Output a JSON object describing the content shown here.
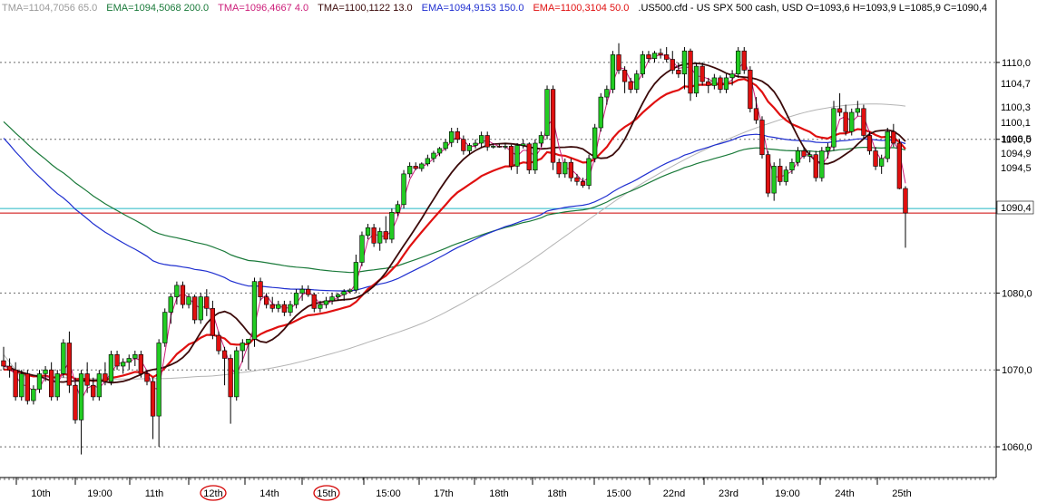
{
  "header": {
    "items": [
      {
        "text": "TMA=1104,7056  65.0",
        "color": "#9a9a9a"
      },
      {
        "text": "EMA=1094,5068  200.0",
        "color": "#1a7a3a"
      },
      {
        "text": "TMA=1096,4667  4.0",
        "color": "#cc1f7a"
      },
      {
        "text": "TMA=1100,1122  13.0",
        "color": "#3b0a0a"
      },
      {
        "text": "EMA=1094,9153  150.0",
        "color": "#1f2fd0"
      },
      {
        "text": "EMA=1100,3104  50.0",
        "color": "#e01010"
      },
      {
        "text": ".US500.cfd - US SPX 500 cash, USD O=1093,6 H=1093,9 L=1085,9 C=1090,4",
        "color": "#000000"
      }
    ]
  },
  "colors": {
    "bull": "#22cc22",
    "bear": "#e01010",
    "grid": "#6a6a6a",
    "tma65": "#b4b4b4",
    "ema200": "#1a7a3a",
    "tma4": "#cc1f7a",
    "tma13": "#3b0a0a",
    "ema150": "#1f2fd0",
    "ema50": "#e01010",
    "cyan": "#22b7c4",
    "redline": "#cc0000"
  },
  "chart_data": {
    "type": "candlestick",
    "symbol": ".US500.cfd",
    "ylim": [
      1056,
      1116
    ],
    "y_ticks": [
      "1110,0",
      "1100,0",
      "1080,0",
      "1070,0",
      "1060,0"
    ],
    "x_ticks": [
      "10th",
      "19:00",
      "11th",
      "12th",
      "14th",
      "15th",
      "15:00",
      "17th",
      "18th",
      "18th",
      "15:00",
      "22nd",
      "23rd",
      "19:00",
      "24th",
      "25th"
    ],
    "circled_x_ticks": [
      "12th",
      "15th"
    ],
    "price_labels": [
      {
        "text": "1104,7",
        "value": 1104.7,
        "series": "tma65"
      },
      {
        "text": "1100,3",
        "value": 1100.3,
        "series": "ema50"
      },
      {
        "text": "1100,1",
        "value": 1100.1,
        "series": "tma13"
      },
      {
        "text": "1096,5",
        "value": 1096.5,
        "series": "tma4"
      },
      {
        "text": "1094,9",
        "value": 1094.9,
        "series": "ema150"
      },
      {
        "text": "1094,5",
        "value": 1094.5,
        "series": "ema200"
      },
      {
        "text": "1090,4",
        "value": 1090.4,
        "series": "last"
      }
    ],
    "horizontal_lines": [
      {
        "value": 1091.0,
        "color": "cyan"
      },
      {
        "value": 1090.4,
        "color": "redline"
      }
    ],
    "candles_ohlc": [
      [
        1071.2,
        1073.0,
        1070.0,
        1070.5
      ],
      [
        1070.5,
        1071.5,
        1069.0,
        1070.0
      ],
      [
        1070.0,
        1071.0,
        1066.0,
        1066.5
      ],
      [
        1066.5,
        1070.0,
        1066.0,
        1069.5
      ],
      [
        1069.5,
        1070.0,
        1065.5,
        1066.0
      ],
      [
        1066.0,
        1068.0,
        1065.5,
        1067.5
      ],
      [
        1067.5,
        1070.0,
        1067.0,
        1069.5
      ],
      [
        1069.5,
        1070.5,
        1068.5,
        1070.0
      ],
      [
        1070.0,
        1071.0,
        1066.0,
        1066.5
      ],
      [
        1066.5,
        1070.0,
        1066.0,
        1069.5
      ],
      [
        1069.5,
        1074.0,
        1069.0,
        1073.5
      ],
      [
        1073.5,
        1075.0,
        1067.0,
        1068.0
      ],
      [
        1068.0,
        1069.0,
        1063.0,
        1063.5
      ],
      [
        1063.5,
        1070.0,
        1059.0,
        1069.5
      ],
      [
        1069.5,
        1071.0,
        1067.0,
        1068.0
      ],
      [
        1068.0,
        1069.0,
        1066.0,
        1066.5
      ],
      [
        1066.5,
        1070.0,
        1066.0,
        1069.5
      ],
      [
        1069.5,
        1071.0,
        1068.0,
        1068.5
      ],
      [
        1068.5,
        1072.5,
        1068.0,
        1072.0
      ],
      [
        1072.0,
        1072.5,
        1070.0,
        1070.5
      ],
      [
        1070.5,
        1071.5,
        1069.5,
        1071.0
      ],
      [
        1071.0,
        1072.0,
        1070.0,
        1071.5
      ],
      [
        1071.5,
        1072.5,
        1070.5,
        1072.0
      ],
      [
        1072.0,
        1072.5,
        1069.0,
        1069.5
      ],
      [
        1069.5,
        1070.0,
        1068.0,
        1068.5
      ],
      [
        1068.5,
        1069.0,
        1061.0,
        1064.0
      ],
      [
        1064.0,
        1074.0,
        1060.0,
        1073.5
      ],
      [
        1073.5,
        1078.0,
        1073.0,
        1077.5
      ],
      [
        1077.5,
        1080.0,
        1076.0,
        1079.5
      ],
      [
        1079.5,
        1081.5,
        1078.5,
        1081.0
      ],
      [
        1081.0,
        1081.5,
        1078.0,
        1078.5
      ],
      [
        1078.5,
        1080.0,
        1078.0,
        1079.5
      ],
      [
        1079.5,
        1079.8,
        1076.0,
        1076.5
      ],
      [
        1076.5,
        1080.0,
        1076.0,
        1079.5
      ],
      [
        1079.5,
        1080.5,
        1077.0,
        1078.0
      ],
      [
        1078.0,
        1079.0,
        1074.0,
        1074.5
      ],
      [
        1074.5,
        1075.0,
        1072.0,
        1072.5
      ],
      [
        1072.5,
        1073.0,
        1068.0,
        1071.5
      ],
      [
        1071.5,
        1072.0,
        1063.0,
        1066.5
      ],
      [
        1066.5,
        1073.0,
        1066.0,
        1072.5
      ],
      [
        1072.5,
        1074.0,
        1071.0,
        1073.5
      ],
      [
        1073.5,
        1074.0,
        1070.0,
        1074.0
      ],
      [
        1074.0,
        1082.0,
        1073.0,
        1081.5
      ],
      [
        1081.5,
        1082.0,
        1079.0,
        1079.5
      ],
      [
        1079.5,
        1080.0,
        1078.0,
        1078.5
      ],
      [
        1078.5,
        1079.5,
        1077.5,
        1078.0
      ],
      [
        1078.0,
        1079.0,
        1077.5,
        1078.5
      ],
      [
        1078.5,
        1079.0,
        1077.0,
        1077.5
      ],
      [
        1077.5,
        1079.0,
        1077.0,
        1078.5
      ],
      [
        1078.5,
        1080.5,
        1078.0,
        1080.0
      ],
      [
        1080.0,
        1081.0,
        1079.0,
        1080.5
      ],
      [
        1080.5,
        1081.0,
        1079.5,
        1079.8
      ],
      [
        1079.8,
        1080.0,
        1077.5,
        1078.0
      ],
      [
        1078.0,
        1079.0,
        1077.5,
        1078.5
      ],
      [
        1078.5,
        1079.5,
        1078.0,
        1079.0
      ],
      [
        1079.0,
        1080.0,
        1078.5,
        1079.5
      ],
      [
        1079.5,
        1080.0,
        1079.0,
        1079.8
      ],
      [
        1079.8,
        1080.5,
        1079.0,
        1080.2
      ],
      [
        1080.2,
        1080.6,
        1080.0,
        1080.4
      ],
      [
        1080.4,
        1085.0,
        1080.0,
        1084.0
      ],
      [
        1084.0,
        1088.0,
        1083.5,
        1087.5
      ],
      [
        1087.5,
        1089.0,
        1087.0,
        1088.5
      ],
      [
        1088.5,
        1089.0,
        1086.0,
        1086.5
      ],
      [
        1086.5,
        1088.5,
        1085.5,
        1088.0
      ],
      [
        1088.0,
        1090.0,
        1086.5,
        1087.0
      ],
      [
        1087.0,
        1091.0,
        1086.5,
        1090.5
      ],
      [
        1090.5,
        1092.0,
        1090.0,
        1091.5
      ],
      [
        1091.5,
        1096.0,
        1091.0,
        1095.5
      ],
      [
        1095.5,
        1097.0,
        1095.0,
        1096.5
      ],
      [
        1096.5,
        1097.0,
        1096.0,
        1096.2
      ],
      [
        1096.2,
        1097.0,
        1095.8,
        1096.8
      ],
      [
        1096.8,
        1098.0,
        1096.5,
        1097.5
      ],
      [
        1097.5,
        1098.5,
        1097.0,
        1098.2
      ],
      [
        1098.2,
        1099.0,
        1097.8,
        1098.8
      ],
      [
        1098.8,
        1100.0,
        1098.5,
        1099.6
      ],
      [
        1099.6,
        1101.5,
        1099.0,
        1101.0
      ],
      [
        1101.0,
        1101.5,
        1099.5,
        1100.0
      ],
      [
        1100.0,
        1100.5,
        1098.0,
        1098.5
      ],
      [
        1098.5,
        1099.5,
        1098.0,
        1099.2
      ],
      [
        1099.2,
        1100.0,
        1098.8,
        1099.5
      ],
      [
        1099.5,
        1101.0,
        1099.0,
        1100.5
      ],
      [
        1100.5,
        1101.0,
        1098.5,
        1099.0
      ],
      [
        1099.0,
        1099.5,
        1098.8,
        1099.1
      ],
      [
        1099.1,
        1099.4,
        1098.9,
        1099.0
      ],
      [
        1099.0,
        1099.5,
        1098.7,
        1099.1
      ],
      [
        1099.1,
        1099.3,
        1096.0,
        1096.5
      ],
      [
        1096.5,
        1099.5,
        1095.5,
        1099.2
      ],
      [
        1099.2,
        1100.0,
        1098.8,
        1099.4
      ],
      [
        1099.4,
        1099.6,
        1095.5,
        1096.0
      ],
      [
        1096.0,
        1100.0,
        1095.5,
        1099.5
      ],
      [
        1099.5,
        1101.0,
        1099.0,
        1100.5
      ],
      [
        1100.5,
        1107.0,
        1100.0,
        1106.5
      ],
      [
        1106.5,
        1107.0,
        1096.0,
        1097.0
      ],
      [
        1097.0,
        1097.5,
        1095.0,
        1095.5
      ],
      [
        1095.5,
        1097.5,
        1095.0,
        1097.0
      ],
      [
        1097.0,
        1097.5,
        1094.5,
        1095.0
      ],
      [
        1095.0,
        1095.5,
        1094.0,
        1094.5
      ],
      [
        1094.5,
        1095.0,
        1093.7,
        1094.0
      ],
      [
        1094.0,
        1098.0,
        1093.5,
        1097.5
      ],
      [
        1097.5,
        1102.0,
        1097.0,
        1101.5
      ],
      [
        1101.5,
        1106.0,
        1101.0,
        1105.5
      ],
      [
        1105.5,
        1107.0,
        1104.5,
        1106.5
      ],
      [
        1106.5,
        1111.5,
        1106.0,
        1111.0
      ],
      [
        1111.0,
        1112.5,
        1108.5,
        1109.0
      ],
      [
        1109.0,
        1109.5,
        1106.0,
        1107.5
      ],
      [
        1107.5,
        1108.0,
        1106.0,
        1106.5
      ],
      [
        1106.5,
        1109.0,
        1106.0,
        1108.5
      ],
      [
        1108.5,
        1111.5,
        1108.0,
        1111.0
      ],
      [
        1111.0,
        1111.5,
        1110.0,
        1110.5
      ],
      [
        1110.5,
        1111.5,
        1110.0,
        1111.2
      ],
      [
        1111.2,
        1111.8,
        1110.5,
        1111.0
      ],
      [
        1111.0,
        1112.0,
        1110.0,
        1110.4
      ],
      [
        1110.4,
        1111.5,
        1108.5,
        1109.0
      ],
      [
        1109.0,
        1110.0,
        1108.0,
        1108.5
      ],
      [
        1108.5,
        1112.0,
        1106.5,
        1111.5
      ],
      [
        1111.5,
        1111.8,
        1105.0,
        1106.0
      ],
      [
        1106.0,
        1110.0,
        1105.5,
        1109.5
      ],
      [
        1109.5,
        1110.0,
        1107.0,
        1107.5
      ],
      [
        1107.5,
        1108.0,
        1106.0,
        1107.0
      ],
      [
        1107.0,
        1108.5,
        1106.5,
        1108.0
      ],
      [
        1108.0,
        1108.3,
        1106.0,
        1106.5
      ],
      [
        1106.5,
        1108.5,
        1106.0,
        1108.0
      ],
      [
        1108.0,
        1109.0,
        1107.0,
        1108.5
      ],
      [
        1108.5,
        1112.0,
        1108.0,
        1111.5
      ],
      [
        1111.5,
        1112.0,
        1108.5,
        1109.0
      ],
      [
        1109.0,
        1109.5,
        1103.5,
        1104.0
      ],
      [
        1104.0,
        1105.5,
        1102.0,
        1102.5
      ],
      [
        1102.5,
        1103.0,
        1097.5,
        1098.0
      ],
      [
        1098.0,
        1098.5,
        1092.5,
        1093.0
      ],
      [
        1093.0,
        1097.0,
        1092.0,
        1096.5
      ],
      [
        1096.5,
        1097.5,
        1094.0,
        1094.5
      ],
      [
        1094.5,
        1096.5,
        1094.0,
        1096.0
      ],
      [
        1096.0,
        1097.5,
        1095.5,
        1097.0
      ],
      [
        1097.0,
        1099.0,
        1096.5,
        1098.5
      ],
      [
        1098.5,
        1099.0,
        1097.5,
        1097.8
      ],
      [
        1097.8,
        1098.5,
        1097.0,
        1098.0
      ],
      [
        1098.0,
        1098.5,
        1094.5,
        1095.0
      ],
      [
        1095.0,
        1099.0,
        1094.5,
        1098.5
      ],
      [
        1098.5,
        1099.5,
        1097.5,
        1099.0
      ],
      [
        1099.0,
        1105.0,
        1098.5,
        1104.0
      ],
      [
        1104.0,
        1106.0,
        1103.0,
        1103.5
      ],
      [
        1103.5,
        1104.5,
        1100.5,
        1101.0
      ],
      [
        1101.0,
        1104.0,
        1100.5,
        1103.5
      ],
      [
        1103.5,
        1105.0,
        1103.0,
        1104.0
      ],
      [
        1104.0,
        1104.5,
        1100.0,
        1100.5
      ],
      [
        1100.5,
        1101.0,
        1098.0,
        1098.5
      ],
      [
        1098.5,
        1099.0,
        1096.0,
        1096.5
      ],
      [
        1096.5,
        1098.0,
        1095.5,
        1097.5
      ],
      [
        1097.5,
        1101.5,
        1097.0,
        1101.0
      ],
      [
        1101.0,
        1102.0,
        1099.0,
        1099.5
      ],
      [
        1099.5,
        1100.0,
        1093.5,
        1093.6
      ],
      [
        1093.6,
        1093.9,
        1085.9,
        1090.4
      ]
    ]
  }
}
